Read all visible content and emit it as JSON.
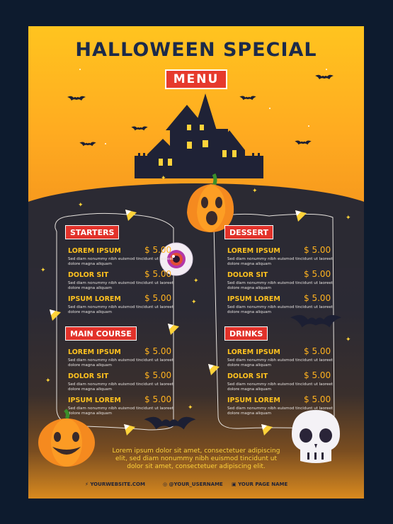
{
  "header": {
    "title": "HALLOWEEN SPECIAL",
    "badge": "MENU"
  },
  "sections": {
    "starters": {
      "label": "STARTERS",
      "items": [
        {
          "name": "LOREM IPSUM",
          "price": "$ 5.00",
          "desc": "Sed diam nonummy nibh euismod tincidunt ut laoreet dolore magna aliquam"
        },
        {
          "name": "DOLOR SIT",
          "price": "$ 5.00",
          "desc": "Sed diam nonummy nibh euismod tincidunt ut laoreet dolore magna aliquam"
        },
        {
          "name": "IPSUM LOREM",
          "price": "$ 5.00",
          "desc": "Sed diam nonummy nibh euismod tincidunt ut laoreet dolore magna aliquam"
        }
      ]
    },
    "dessert": {
      "label": "DESSERT",
      "items": [
        {
          "name": "LOREM IPSUM",
          "price": "$ 5.00",
          "desc": "Sed diam nonummy nibh euismod tincidunt ut laoreet dolore magna aliquam"
        },
        {
          "name": "DOLOR SIT",
          "price": "$ 5.00",
          "desc": "Sed diam nonummy nibh euismod tincidunt ut laoreet dolore magna aliquam"
        },
        {
          "name": "IPSUM LOREM",
          "price": "$ 5.00",
          "desc": "Sed diam nonummy nibh euismod tincidunt ut laoreet dolore magna aliquam"
        }
      ]
    },
    "main_course": {
      "label": "MAIN COURSE",
      "items": [
        {
          "name": "LOREM IPSUM",
          "price": "$ 5.00",
          "desc": "Sed diam nonummy nibh euismod tincidunt ut laoreet dolore magna aliquam"
        },
        {
          "name": "DOLOR SIT",
          "price": "$ 5.00",
          "desc": "Sed diam nonummy nibh euismod tincidunt ut laoreet dolore magna aliquam"
        },
        {
          "name": "IPSUM LOREM",
          "price": "$ 5.00",
          "desc": "Sed diam nonummy nibh euismod tincidunt ut laoreet dolore magna aliquam"
        }
      ]
    },
    "drinks": {
      "label": "DRINKS",
      "items": [
        {
          "name": "LOREM IPSUM",
          "price": "$ 5.00",
          "desc": "Sed diam nonummy nibh euismod tincidunt ut laoreet dolore magna aliquam"
        },
        {
          "name": "DOLOR SIT",
          "price": "$ 5.00",
          "desc": "Sed diam nonummy nibh euismod tincidunt ut laoreet dolore magna aliquam"
        },
        {
          "name": "IPSUM LOREM",
          "price": "$ 5.00",
          "desc": "Sed diam nonummy nibh euismod tincidunt ut laoreet dolore magna aliquam"
        }
      ]
    }
  },
  "footer": {
    "line1": "Lorem ipsum dolor sit amet, consectetuer adipiscing",
    "line2": "elit, sed diam nonummy nibh euismod tincidunt ut",
    "line3": "dolor sit amet, consectetuer adipiscing elit.",
    "website": "YOURWEBSITE.COM",
    "username": "@YOUR_USERNAME",
    "page_name": "YOUR PAGE NAME"
  },
  "colors": {
    "accent": "#e2322a",
    "gold": "#ffc21f",
    "night": "#2b2a33",
    "navy": "#1c2a4a"
  },
  "icons": [
    "bat-icon",
    "haunted-house-icon",
    "pumpkin-icon",
    "eyeball-icon",
    "candy-corn-icon",
    "skull-icon",
    "star-icon",
    "globe-icon",
    "instagram-icon",
    "facebook-icon"
  ]
}
